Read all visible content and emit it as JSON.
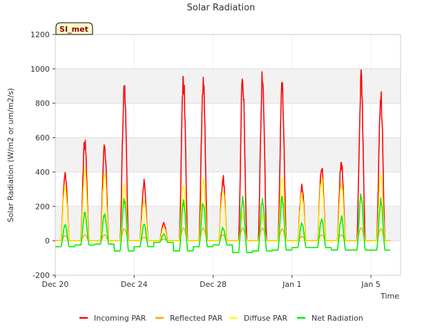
{
  "chart_data": {
    "type": "line",
    "title": "Solar Radiation",
    "xlabel": "Time",
    "ylabel": "Solar Radiation (W/m2 or um/m2/s)",
    "ylim": [
      -200,
      1200
    ],
    "yticks": [
      -200,
      0,
      200,
      400,
      600,
      800,
      1000,
      1200
    ],
    "xlim": [
      "2021-12-20",
      "2022-01-06 12:00"
    ],
    "xticks": [
      {
        "label": "Dec 20",
        "date": "2021-12-20"
      },
      {
        "label": "Dec 24",
        "date": "2021-12-24"
      },
      {
        "label": "Dec 28",
        "date": "2021-12-28"
      },
      {
        "label": "Jan 1",
        "date": "2022-01-01"
      },
      {
        "label": "Jan 5",
        "date": "2022-01-05"
      }
    ],
    "grid": true,
    "legend_position": "bottom",
    "site_label": "SI_met",
    "series": [
      {
        "name": "Incoming PAR",
        "color": "#ff0000"
      },
      {
        "name": "Reflected PAR",
        "color": "#ffa500"
      },
      {
        "name": "Diffuse PAR",
        "color": "#ffff00"
      },
      {
        "name": "Net Radiation",
        "color": "#00ee00"
      }
    ],
    "days": [
      {
        "date": "2021-12-20",
        "incoming_peak": 405,
        "reflected_peak": 30,
        "diffuse_peak": 330,
        "net_peak": 95,
        "net_night": -35
      },
      {
        "date": "2021-12-21",
        "incoming_peak": 620,
        "reflected_peak": 35,
        "diffuse_peak": 435,
        "net_peak": 175,
        "net_night": -25
      },
      {
        "date": "2021-12-22",
        "incoming_peak": 590,
        "reflected_peak": 35,
        "diffuse_peak": 420,
        "net_peak": 165,
        "net_night": -20
      },
      {
        "date": "2021-12-23",
        "incoming_peak": 965,
        "reflected_peak": 70,
        "diffuse_peak": 340,
        "net_peak": 265,
        "net_night": -60
      },
      {
        "date": "2021-12-24",
        "incoming_peak": 360,
        "reflected_peak": 20,
        "diffuse_peak": 250,
        "net_peak": 100,
        "net_night": -35
      },
      {
        "date": "2021-12-25",
        "incoming_peak": 110,
        "reflected_peak": 10,
        "diffuse_peak": 85,
        "net_peak": 40,
        "net_night": -10
      },
      {
        "date": "2021-12-26",
        "incoming_peak": 985,
        "reflected_peak": 75,
        "diffuse_peak": 335,
        "net_peak": 250,
        "net_night": -60
      },
      {
        "date": "2021-12-27",
        "incoming_peak": 980,
        "reflected_peak": 75,
        "diffuse_peak": 370,
        "net_peak": 240,
        "net_night": -35
      },
      {
        "date": "2021-12-28",
        "incoming_peak": 390,
        "reflected_peak": 35,
        "diffuse_peak": 330,
        "net_peak": 80,
        "net_night": -25
      },
      {
        "date": "2021-12-29",
        "incoming_peak": 1010,
        "reflected_peak": 75,
        "diffuse_peak": 170,
        "net_peak": 260,
        "net_night": -70
      },
      {
        "date": "2021-12-30",
        "incoming_peak": 1010,
        "reflected_peak": 75,
        "diffuse_peak": 155,
        "net_peak": 255,
        "net_night": -60
      },
      {
        "date": "2021-12-31",
        "incoming_peak": 940,
        "reflected_peak": 70,
        "diffuse_peak": 400,
        "net_peak": 275,
        "net_night": -55
      },
      {
        "date": "2022-01-01",
        "incoming_peak": 350,
        "reflected_peak": 25,
        "diffuse_peak": 295,
        "net_peak": 110,
        "net_night": -40
      },
      {
        "date": "2022-01-02",
        "incoming_peak": 470,
        "reflected_peak": 35,
        "diffuse_peak": 385,
        "net_peak": 140,
        "net_night": -40
      },
      {
        "date": "2022-01-03",
        "incoming_peak": 490,
        "reflected_peak": 35,
        "diffuse_peak": 360,
        "net_peak": 150,
        "net_night": -55
      },
      {
        "date": "2022-01-04",
        "incoming_peak": 995,
        "reflected_peak": 75,
        "diffuse_peak": 250,
        "net_peak": 285,
        "net_night": -55
      },
      {
        "date": "2022-01-05",
        "incoming_peak": 895,
        "reflected_peak": 70,
        "diffuse_peak": 410,
        "net_peak": 255,
        "net_night": -55
      }
    ]
  }
}
